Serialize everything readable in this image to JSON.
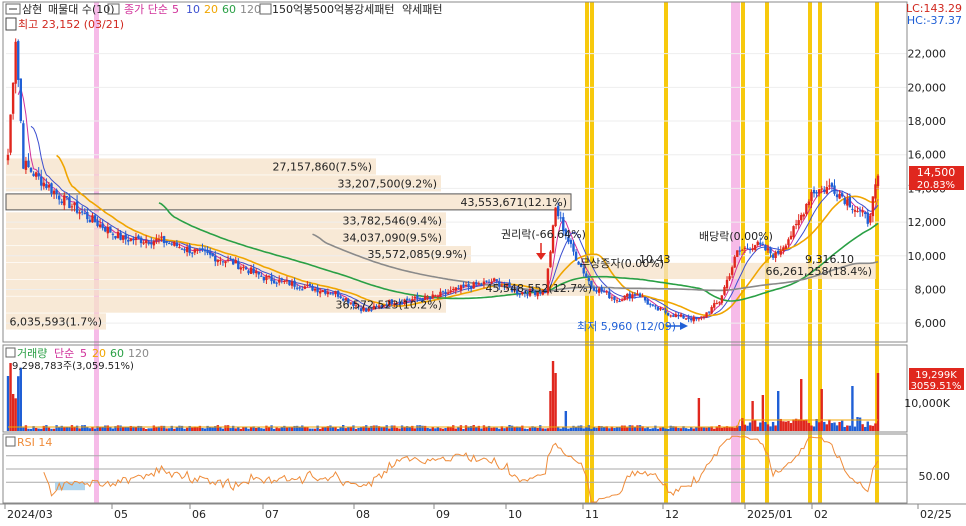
{
  "header": {
    "stock_name": "삼현",
    "profile_label": "매물대 수(10)",
    "ma_label": "종가 단순",
    "ma_periods": [
      "5",
      "10",
      "20",
      "60",
      "120"
    ],
    "extra_labels": [
      "150억봉",
      "500억봉",
      "강세패턴",
      "약세패턴"
    ],
    "lc_label": "LC:143.29",
    "hc_label": "HC:-37.37"
  },
  "colors": {
    "up": "#e0271e",
    "down": "#1f5fd6",
    "ma5": "#d0309a",
    "ma10": "#3c4fd0",
    "ma20": "#f0a500",
    "ma60": "#2aa045",
    "ma120": "#8a8a8a",
    "profile": "#f5e1c8",
    "event_yellow": "#f7c600",
    "event_pink": "#f5b4e6",
    "rsi": "#ef8c3a",
    "price_badge": "#e0271e"
  },
  "annotations": {
    "high": "최고 23,152 (03/21)",
    "low": "최저 5,960 (12/09)",
    "rights": "권리락(-66.64%)",
    "bonus": "무상증자(0.00%)",
    "dividend": "배당락(0.00%)"
  },
  "volume_panel": {
    "label": "거래량",
    "ma_label": "단순",
    "ma_periods": [
      "5",
      "20",
      "60",
      "120"
    ],
    "max_label": "9,298,783주(3,059.51%)",
    "tick_label": "10,000K",
    "current_value": "19,299K",
    "current_pct": "3059.51%"
  },
  "rsi_panel": {
    "label": "RSI 14",
    "tick_label": "50.00"
  },
  "price_badge": {
    "value": "14,500",
    "pct": "20.83%"
  },
  "chart_data": [
    {
      "type": "candlestick",
      "name": "price",
      "y_ticks": [
        "22,000",
        "20,000",
        "18,000",
        "16,000",
        "14,000",
        "12,000",
        "10,000",
        "8,000",
        "6,000"
      ],
      "x_ticks": [
        "2024/03",
        "05",
        "06",
        "07",
        "08",
        "09",
        "10",
        "11",
        "12",
        "2025/01",
        "02",
        "02/25"
      ],
      "ylim": [
        5000,
        24000
      ],
      "volume_profile": [
        {
          "label": "27,157,860(7.5%)",
          "price": 15300
        },
        {
          "label": "33,207,500(9.2%)",
          "price": 14300
        },
        {
          "label": "43,553,671(12.1%)",
          "price": 13200
        },
        {
          "label": "33,782,546(9.4%)",
          "price": 12100
        },
        {
          "label": "34,037,090(9.5%)",
          "price": 11100
        },
        {
          "label": "35,572,085(9.9%)",
          "price": 10100
        },
        {
          "label": "66,261,258(18.4%)",
          "price": 9100
        },
        {
          "label": "45,548,552(12.7%)",
          "price": 8100
        },
        {
          "label": "36,572,523(10.2%)",
          "price": 7100
        },
        {
          "label": "6,035,593(1.7%)",
          "price": 6100
        }
      ],
      "labels_on_chart": [
        "9,316.10",
        "10,43"
      ]
    },
    {
      "type": "bar",
      "name": "volume",
      "yticks": [
        "10,000K"
      ]
    },
    {
      "type": "line",
      "name": "RSI 14",
      "ylim": [
        0,
        100
      ],
      "yticks": [
        "50.00"
      ]
    }
  ]
}
